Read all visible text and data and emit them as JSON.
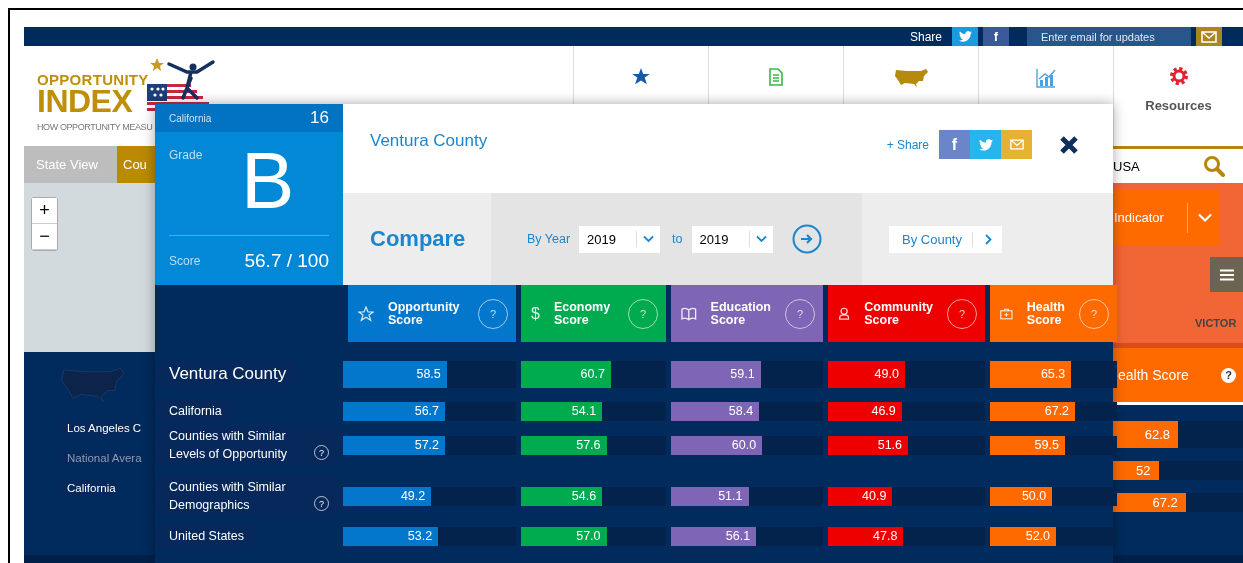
{
  "top_bar": {
    "share_label": "Share",
    "facebook": "f",
    "email_placeholder": "Enter email for updates"
  },
  "logo": {
    "line_1": "OPPORTUNITY",
    "line_2": "INDEX",
    "tagline": "HOW OPPORTUNITY MEASU"
  },
  "nav": {
    "resources_label": "Resources"
  },
  "view_tabs": [
    {
      "label": "State View",
      "selected": false
    },
    {
      "label": "Cou",
      "selected": true
    }
  ],
  "search": {
    "value": "USA"
  },
  "map": {
    "zoom_in": "+",
    "zoom_out": "−",
    "region_label": "VICTOR"
  },
  "indicator_dropdown": {
    "label": "Indicator"
  },
  "places": [
    {
      "label": "Los Angeles C",
      "dimmed": false
    },
    {
      "label": "National Avera",
      "dimmed": true
    },
    {
      "label": "California",
      "dimmed": false
    }
  ],
  "side_panel": {
    "title": "ealth Score",
    "help": "?",
    "bars": [
      {
        "value": "62.8",
        "level": 0.5
      },
      {
        "value": "52",
        "level": 0.35
      },
      {
        "value": "67.2",
        "level": 0.56
      }
    ]
  },
  "modal": {
    "state": "California",
    "rank": "16",
    "grade_label": "Grade",
    "grade": "B",
    "score_label": "Score",
    "score": "56.7 / 100",
    "title": "Ventura County",
    "share_label": "+ Share",
    "facebook": "f",
    "compare_label": "Compare",
    "by_year_label": "By Year",
    "year_from": "2019",
    "to_label": "to",
    "year_to": "2019",
    "by_county_label": "By County",
    "columns": [
      {
        "label": "Opportunity Score",
        "kind": "star",
        "color": "#0277cc",
        "help": "?"
      },
      {
        "label": "Economy Score",
        "kind": "dollar",
        "symbol": "$",
        "color": "#00aa4f",
        "help": "?"
      },
      {
        "label": "Education Score",
        "kind": "book",
        "color": "#7e65b5",
        "help": "?"
      },
      {
        "label": "Community Score",
        "kind": "person",
        "color": "#ee0000",
        "help": "?"
      },
      {
        "label": "Health Score",
        "kind": "medkit",
        "color": "#ff6a00",
        "help": "?"
      }
    ],
    "rows": [
      {
        "label": "Ventura County",
        "kind": "primary",
        "cells": [
          {
            "value": "58.5",
            "level": 0.6
          },
          {
            "value": "60.7",
            "level": 0.62
          },
          {
            "value": "59.1",
            "level": 0.59
          },
          {
            "value": "49.0",
            "level": 0.49
          },
          {
            "value": "65.3",
            "level": 0.64
          }
        ]
      },
      {
        "label": "California",
        "kind": "plain",
        "cells": [
          {
            "value": "56.7",
            "level": 0.59
          },
          {
            "value": "54.1",
            "level": 0.56
          },
          {
            "value": "58.4",
            "level": 0.58
          },
          {
            "value": "46.9",
            "level": 0.47
          },
          {
            "value": "67.2",
            "level": 0.67
          }
        ]
      },
      {
        "label": "Counties with Similar Levels of Opportunity",
        "kind": "plain",
        "help": "?",
        "cells": [
          {
            "value": "57.2",
            "level": 0.59
          },
          {
            "value": "57.6",
            "level": 0.59
          },
          {
            "value": "60.0",
            "level": 0.6
          },
          {
            "value": "51.6",
            "level": 0.51
          },
          {
            "value": "59.5",
            "level": 0.59
          }
        ]
      },
      {
        "label": "Counties with Similar Demographics",
        "kind": "plain",
        "help": "?",
        "cells": [
          {
            "value": "49.2",
            "level": 0.51
          },
          {
            "value": "54.6",
            "level": 0.56
          },
          {
            "value": "51.1",
            "level": 0.51
          },
          {
            "value": "40.9",
            "level": 0.41
          },
          {
            "value": "50.0",
            "level": 0.49
          }
        ]
      },
      {
        "label": "United States",
        "kind": "plain",
        "cells": [
          {
            "value": "53.2",
            "level": 0.55
          },
          {
            "value": "57.0",
            "level": 0.59
          },
          {
            "value": "56.1",
            "level": 0.56
          },
          {
            "value": "47.8",
            "level": 0.48
          },
          {
            "value": "52.0",
            "level": 0.52
          }
        ]
      }
    ]
  }
}
